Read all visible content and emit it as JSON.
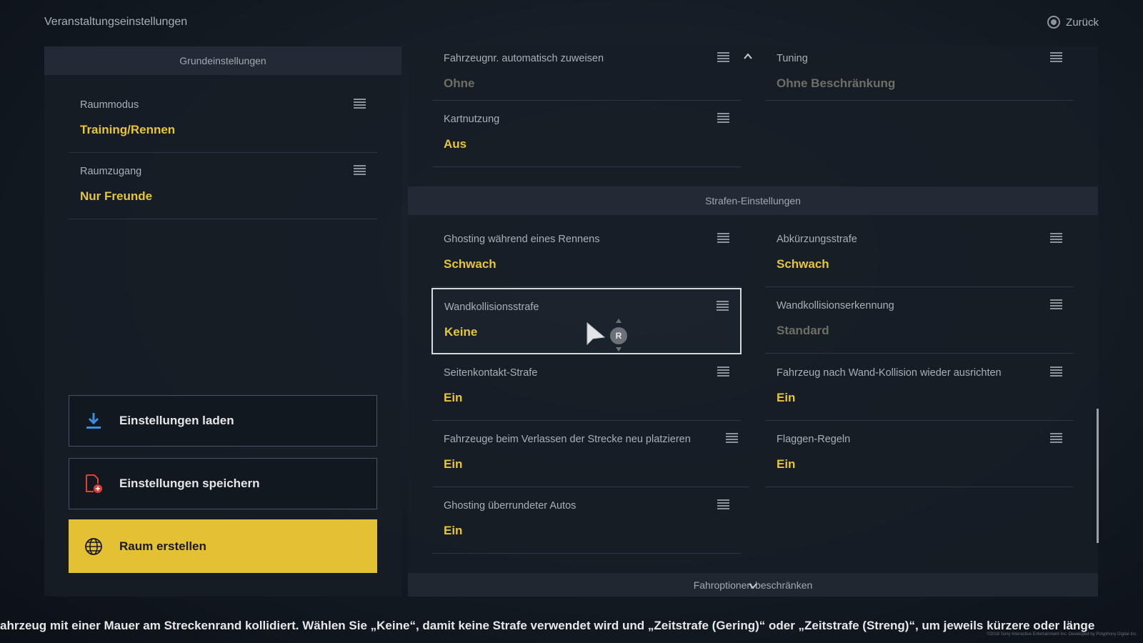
{
  "header": {
    "title": "Veranstaltungseinstellungen",
    "back_label": "Zurück"
  },
  "left_panel": {
    "header": "Grundeinstellungen",
    "settings": [
      {
        "label": "Raummodus",
        "value": "Training/Rennen"
      },
      {
        "label": "Raumzugang",
        "value": "Nur Freunde"
      }
    ],
    "buttons": {
      "load": "Einstellungen laden",
      "save": "Einstellungen speichern",
      "create": "Raum erstellen"
    }
  },
  "right_panel": {
    "top_settings": [
      {
        "label": "Fahrzeugnr. automatisch zuweisen",
        "value": "Ohne"
      },
      {
        "label": "Tuning",
        "value": "Ohne Beschränkung"
      },
      {
        "label": "Kartnutzung",
        "value": "Aus"
      }
    ],
    "penalty_section": "Strafen-Einstellungen",
    "penalty_settings": [
      {
        "label": "Ghosting während eines Rennens",
        "value": "Schwach"
      },
      {
        "label": "Abkürzungsstrafe",
        "value": "Schwach"
      },
      {
        "label": "Wandkollisionsstrafe",
        "value": "Keine"
      },
      {
        "label": "Wandkollisionserkennung",
        "value": "Standard"
      },
      {
        "label": "Seitenkontakt-Strafe",
        "value": "Ein"
      },
      {
        "label": "Fahrzeug nach Wand-Kollision wieder ausrichten",
        "value": "Ein"
      },
      {
        "label": "Fahrzeuge beim Verlassen der Strecke neu platzieren",
        "value": "Ein"
      },
      {
        "label": "Flaggen-Regeln",
        "value": "Ein"
      },
      {
        "label": "Ghosting überrundeter Autos",
        "value": "Ein"
      }
    ],
    "bottom_section": "Fahroptionen beschränken"
  },
  "controller_hint": "R",
  "help_text": "ahrzeug mit einer Mauer am Streckenrand kollidiert. Wählen Sie „Keine“, damit keine Strafe verwendet wird und „Zeitstrafe (Gering)“ oder „Zeitstrafe (Streng)“, um jeweils kürzere oder länge",
  "copyright": "©2018 Sony Interactive Entertainment Inc. Developed by Polyphony Digital Inc.",
  "colors": {
    "accent_yellow": "#e7c43a",
    "button_yellow": "#e3c133",
    "dim_value": "#6e6f64",
    "panel_bg": "#161d26"
  }
}
